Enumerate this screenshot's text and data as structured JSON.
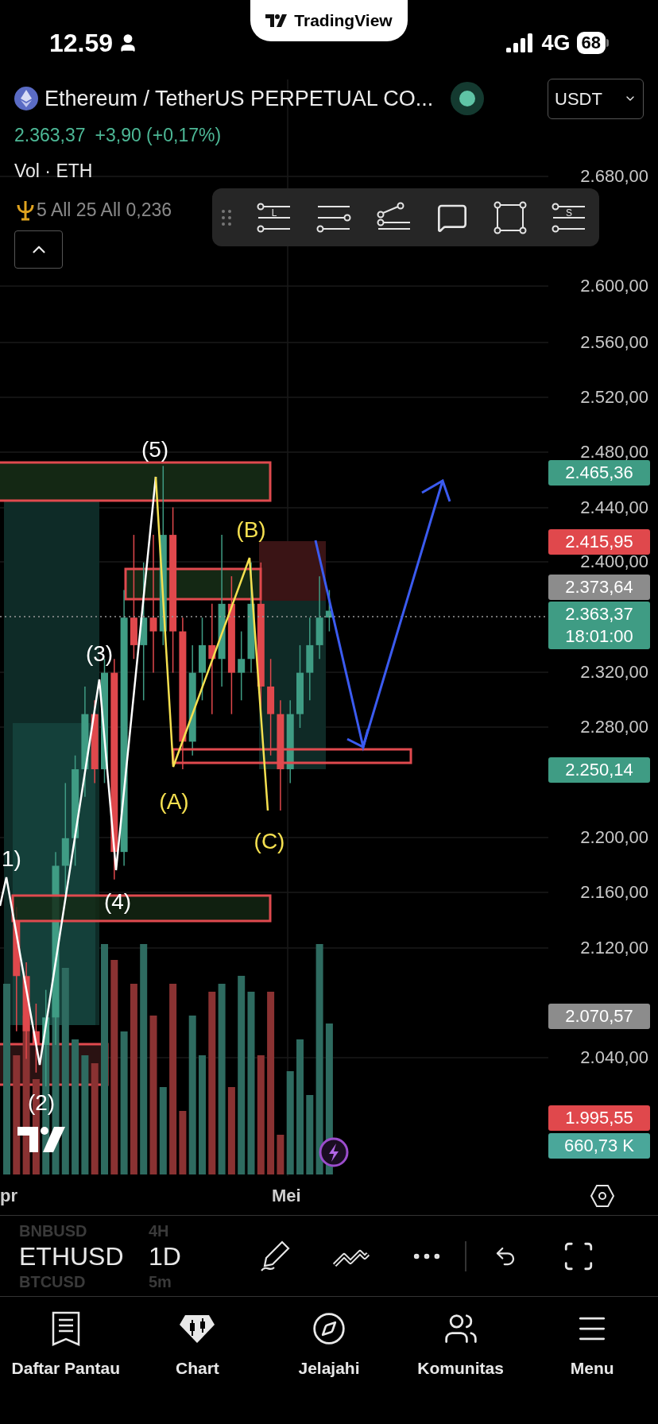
{
  "status_bar": {
    "time": "12.59",
    "network": "4G",
    "battery": "68"
  },
  "brand": {
    "name": "TradingView"
  },
  "header": {
    "title": "Ethereum / TetherUS PERPETUAL CO...",
    "currency": "USDT",
    "price": "2.363,37",
    "change": "+3,90 (+0,17%)",
    "volume_legend": "Vol · ETH",
    "indicator_legend": "5 All 25 All 0,236"
  },
  "floating_toolbar": {
    "tools": [
      {
        "kind": "long",
        "letter": "L"
      },
      {
        "kind": "parallel"
      },
      {
        "kind": "path"
      },
      {
        "kind": "callout"
      },
      {
        "kind": "rectangle"
      },
      {
        "kind": "short",
        "letter": "S"
      }
    ]
  },
  "price_axis": {
    "labels": [
      "2.680,00",
      "2.600,00",
      "2.560,00",
      "2.520,00",
      "2.480,00",
      "2.440,00",
      "2.400,00",
      "2.320,00",
      "2.280,00",
      "2.200,00",
      "2.160,00",
      "2.120,00",
      "2.040,00"
    ]
  },
  "price_badges": [
    {
      "lines": [
        "2.465,36"
      ],
      "color": "#3f9c84"
    },
    {
      "lines": [
        "2.415,95"
      ],
      "color": "#e0484c"
    },
    {
      "lines": [
        "2.373,64"
      ],
      "color": "#8c8c8c"
    },
    {
      "lines": [
        "2.363,37",
        "18:01:00"
      ],
      "color": "#3f9c84"
    },
    {
      "lines": [
        "2.250,14"
      ],
      "color": "#3f9c84"
    },
    {
      "lines": [
        "2.070,57"
      ],
      "color": "#8c8c8c"
    },
    {
      "lines": [
        "1.995,55"
      ],
      "color": "#e0484c"
    },
    {
      "lines": [
        "660,73 K"
      ],
      "color": "#4aa79a"
    }
  ],
  "wave_labels": [
    {
      "label": "(5)",
      "color": "#ffffff"
    },
    {
      "label": "(B)",
      "color": "#f5e050"
    },
    {
      "label": "(3)",
      "color": "#ffffff"
    },
    {
      "label": "(A)",
      "color": "#f5e050"
    },
    {
      "label": "(C)",
      "color": "#f5e050"
    },
    {
      "label": "1)",
      "color": "#ffffff"
    },
    {
      "label": "(4)",
      "color": "#ffffff"
    },
    {
      "label": "(2)",
      "color": "#ffffff"
    }
  ],
  "time_axis": {
    "labels": [
      "pr",
      "Mei"
    ]
  },
  "symbol_picker": {
    "previous": "BNBUSD",
    "current": "ETHUSD",
    "next": "BTCUSD"
  },
  "interval_picker": {
    "previous": "4H",
    "current": "1D",
    "next": "5m"
  },
  "nav": [
    {
      "label": "Daftar Pantau"
    },
    {
      "label": "Chart"
    },
    {
      "label": "Jelajahi"
    },
    {
      "label": "Komunitas"
    },
    {
      "label": "Menu"
    }
  ]
}
